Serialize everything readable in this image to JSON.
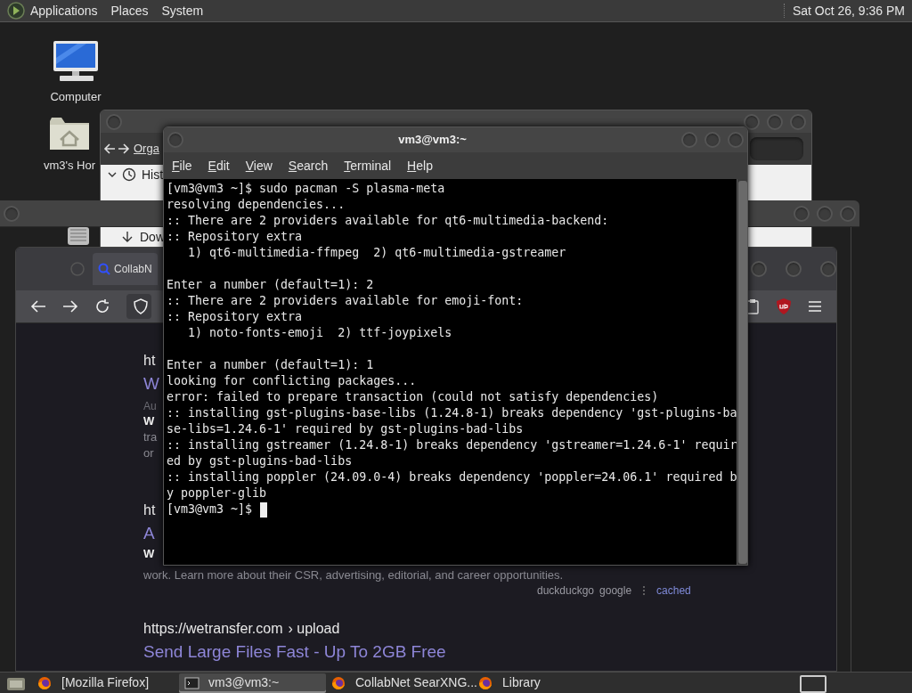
{
  "top_panel": {
    "menus": [
      "Applications",
      "Places",
      "System"
    ],
    "clock": "Sat Oct 26, 9:36 PM"
  },
  "desktop_icons": [
    {
      "kind": "computer",
      "label": "Computer"
    },
    {
      "kind": "home",
      "label": "vm3's Hor"
    },
    {
      "kind": "trash"
    }
  ],
  "library_window": {
    "toolbar_label": "Orga",
    "sidebar": [
      {
        "kind": "history",
        "label": "Hist"
      },
      {
        "kind": "downloads",
        "label": "Dow"
      }
    ]
  },
  "browser": {
    "tab": "CollabN",
    "results": [
      {
        "url": "ht",
        "title": "W",
        "meta": "Au",
        "snippet": [
          {
            "text": "W",
            "bold": true
          },
          {
            "text": "tra",
            "bold": false
          },
          {
            "text": "or",
            "bold": false
          }
        ]
      },
      {
        "url": "ht",
        "title": "A",
        "snippet": [
          {
            "text": "W",
            "bold": true
          },
          {
            "text": "work. Learn more about their CSR, advertising, editorial, and career opportunities.",
            "bold": false
          }
        ],
        "engines": [
          "duckduckgo",
          "google"
        ],
        "cached": "cached"
      },
      {
        "url": "https://wetransfer.com",
        "path": "› upload",
        "title": "Send Large Files Fast - Up To 2GB Free"
      }
    ]
  },
  "terminal": {
    "title": "vm3@vm3:~",
    "menus": [
      "File",
      "Edit",
      "View",
      "Search",
      "Terminal",
      "Help"
    ],
    "blocks": [
      [
        "[vm3@vm3 ~]$ sudo pacman -S plasma-meta",
        "resolving dependencies...",
        ":: There are 2 providers available for qt6-multimedia-backend:",
        ":: Repository extra",
        "   1) qt6-multimedia-ffmpeg  2) qt6-multimedia-gstreamer"
      ],
      [
        "Enter a number (default=1): 2",
        ":: There are 2 providers available for emoji-font:",
        ":: Repository extra",
        "   1) noto-fonts-emoji  2) ttf-joypixels"
      ],
      [
        "Enter a number (default=1): 1",
        "looking for conflicting packages...",
        "error: failed to prepare transaction (could not satisfy dependencies)",
        ":: installing gst-plugins-base-libs (1.24.8-1) breaks dependency 'gst-plugins-ba",
        "se-libs=1.24.6-1' required by gst-plugins-bad-libs",
        ":: installing gstreamer (1.24.8-1) breaks dependency 'gstreamer=1.24.6-1' requir",
        "ed by gst-plugins-bad-libs",
        ":: installing poppler (24.09.0-4) breaks dependency 'poppler=24.06.1' required b",
        "y poppler-glib",
        "[vm3@vm3 ~]$"
      ]
    ]
  },
  "taskbar": {
    "items": [
      {
        "kind": "firefox",
        "label": "[Mozilla Firefox]",
        "selected": false
      },
      {
        "kind": "terminal",
        "label": "vm3@vm3:~",
        "selected": true
      },
      {
        "kind": "firefox",
        "label": "CollabNet SearXNG...",
        "selected": false
      },
      {
        "kind": "firefox",
        "label": "Library",
        "selected": false
      }
    ]
  }
}
